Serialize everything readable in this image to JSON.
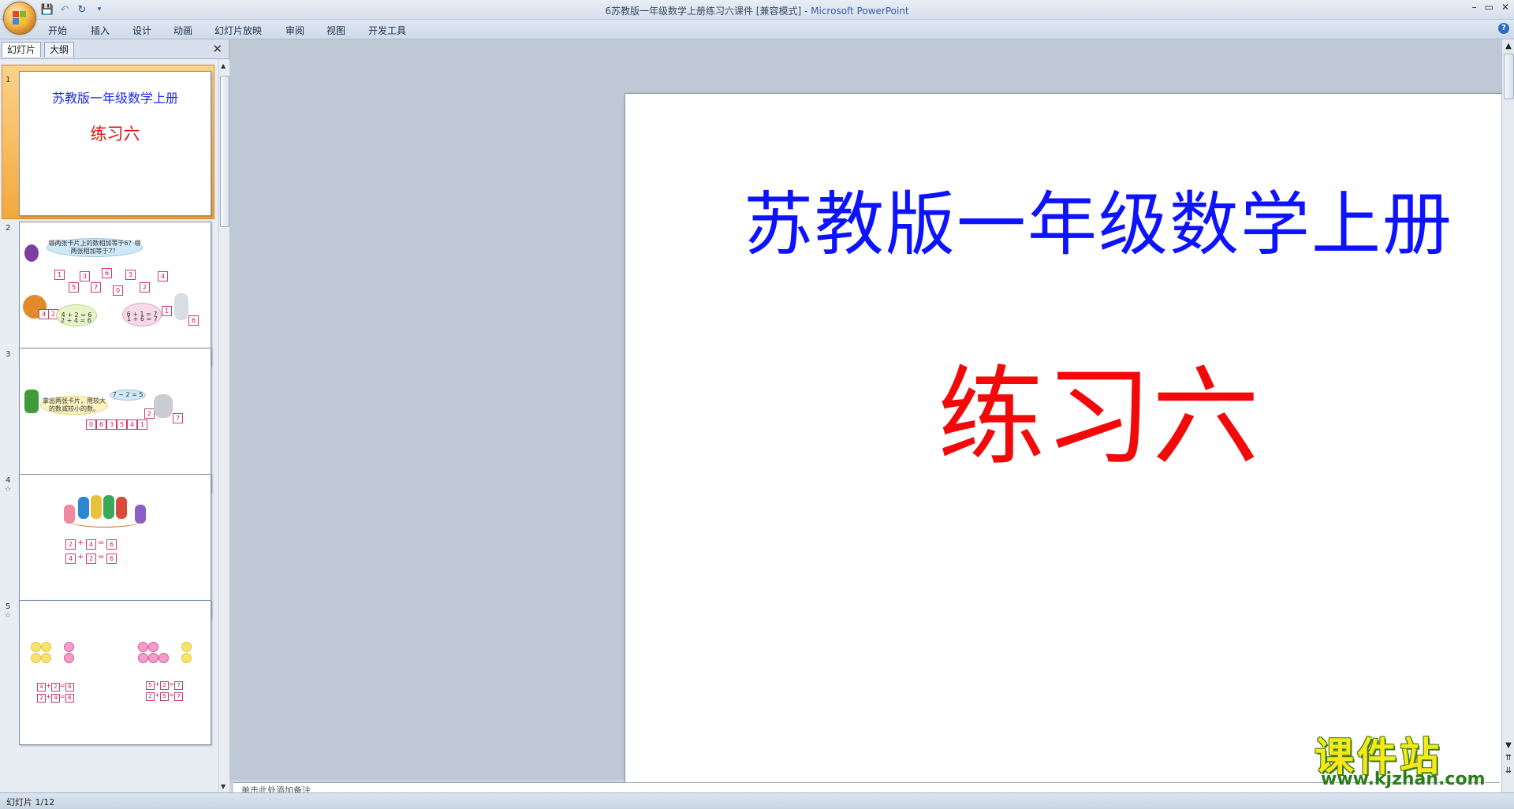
{
  "window": {
    "title": "6苏教版一年级数学上册练习六课件 [兼容模式] - ",
    "app_name": "Microsoft PowerPoint",
    "controls": [
      "–",
      "▭",
      "✕"
    ]
  },
  "ribbon": {
    "tabs": [
      "开始",
      "插入",
      "设计",
      "动画",
      "幻灯片放映",
      "审阅",
      "视图",
      "开发工具"
    ],
    "help": "?"
  },
  "quick_access": {
    "save_icon": "floppy-disk",
    "undo_icon": "undo-arrow",
    "redo_icon": "redo-arrow",
    "customize_icon": "dropdown"
  },
  "left_panel": {
    "tab_slides": "幻灯片",
    "tab_outline": "大纲",
    "close": "✕",
    "thumbnails": [
      {
        "number": "1",
        "title": "苏教版一年级数学上册",
        "subtitle": "练习六"
      },
      {
        "number": "2",
        "bubble": "哪两张卡片上的数相加等于6？哪两张相加等于7？",
        "cards": [
          "1",
          "3",
          "6",
          "3",
          "4",
          "5",
          "7",
          "0",
          "2"
        ],
        "eq_left_1": "4 + 2 = 6",
        "eq_left_2": "2 + 4 = 6",
        "eq_right_1": "6 + 1 = 7",
        "eq_right_2": "1 + 6 = 7",
        "side_cards": [
          "4",
          "2",
          "1",
          "6"
        ]
      },
      {
        "number": "3",
        "bubble": "拿出两张卡片，用较大的数减较小的数。",
        "eq": "7 − 2 = 5",
        "cards": [
          "0",
          "6",
          "3",
          "5",
          "4",
          "1"
        ],
        "side_cards": [
          "2",
          "7"
        ]
      },
      {
        "number": "4",
        "star": "☆",
        "eq1": [
          "2",
          "+",
          "4",
          "=",
          "6"
        ],
        "eq2": [
          "4",
          "+",
          "2",
          "=",
          "6"
        ]
      },
      {
        "number": "5",
        "star": "☆",
        "eq_l1": [
          "4",
          "+",
          "2",
          "=",
          "6"
        ],
        "eq_l2": [
          "2",
          "+",
          "4",
          "=",
          "6"
        ],
        "eq_r1": [
          "5",
          "+",
          "2",
          "=",
          "7"
        ],
        "eq_r2": [
          "2",
          "+",
          "5",
          "=",
          "7"
        ]
      }
    ]
  },
  "slide": {
    "title": "苏教版一年级数学上册",
    "subtitle": "练习六",
    "title_color": "#0d13ff",
    "subtitle_color": "#f20a0a"
  },
  "notes": {
    "placeholder": "单击此处添加备注"
  },
  "status": {
    "slide_indicator": "幻灯片 1/12"
  },
  "watermark": {
    "text": "课件站",
    "url": "www.kjzhan.com"
  }
}
